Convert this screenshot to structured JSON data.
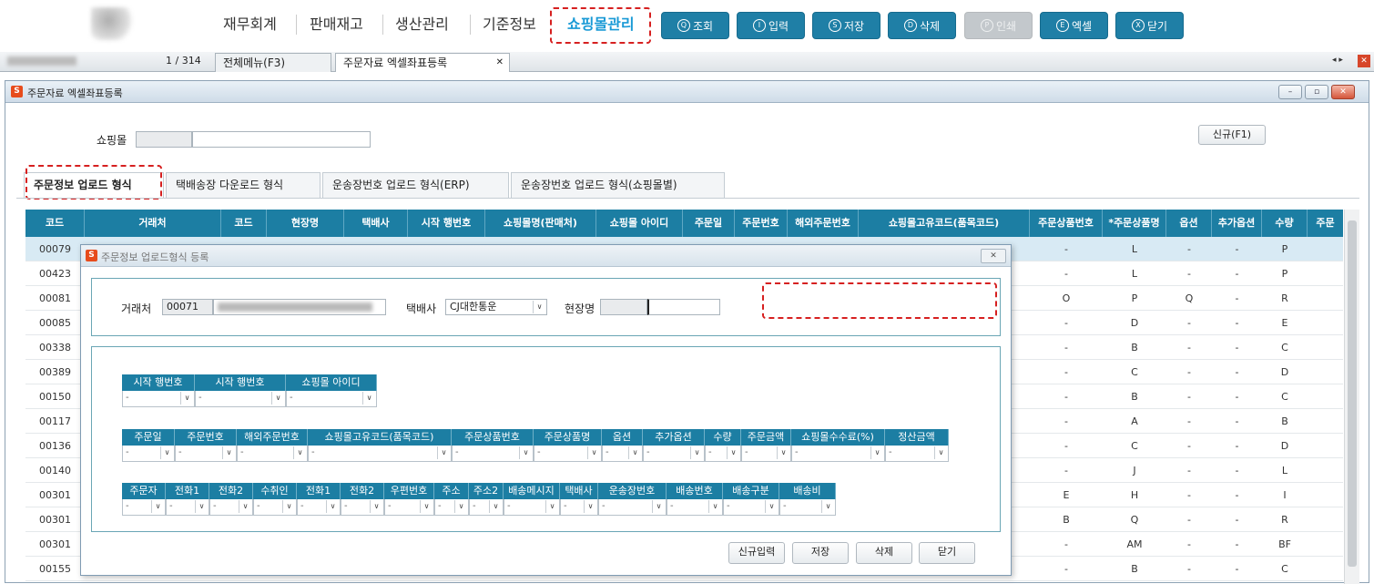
{
  "top_menu": {
    "items": [
      "재무회계",
      "판매재고",
      "생산관리",
      "기준정보",
      "쇼핑몰관리"
    ],
    "active": "쇼핑몰관리"
  },
  "toolbar": {
    "buttons": [
      {
        "key": "Q",
        "label": "조회",
        "enabled": true
      },
      {
        "key": "I",
        "label": "입력",
        "enabled": true
      },
      {
        "key": "S",
        "label": "저장",
        "enabled": true
      },
      {
        "key": "D",
        "label": "삭제",
        "enabled": true
      },
      {
        "key": "P",
        "label": "인쇄",
        "enabled": false
      },
      {
        "key": "E",
        "label": "엑셀",
        "enabled": true
      },
      {
        "key": "X",
        "label": "닫기",
        "enabled": true
      }
    ]
  },
  "program_tabs": {
    "counter": "1 / 314",
    "tabs": [
      {
        "label": "전체메뉴(F3)",
        "active": false
      },
      {
        "label": "주문자료 엑셀좌표등록",
        "active": true,
        "close": "✕"
      }
    ]
  },
  "window": {
    "title": "주문자료 엑셀좌표등록",
    "shop_label": "쇼핑몰",
    "new_button": "신규(F1)",
    "subtabs": [
      "주문정보 업로드 형식",
      "택배송장 다운로드 형식",
      "운송장번호 업로드 형식(ERP)",
      "운송장번호 업로드 형식(쇼핑몰별)"
    ]
  },
  "grid": {
    "columns": [
      "코드",
      "거래처",
      "코드",
      "현장명",
      "택배사",
      "시작 행번호",
      "쇼핑몰명(판매처)",
      "쇼핑몰 아이디",
      "주문일",
      "주문번호",
      "해외주문번호",
      "쇼핑몰고유코드(품목코드)",
      "주문상품번호",
      "*주문상품명",
      "옵션",
      "추가옵션",
      "수량",
      "주문"
    ],
    "rows": [
      {
        "code": "00079",
        "product_no": "-",
        "product_name": "L",
        "option": "-",
        "extra": "-",
        "qty": "P",
        "selected": true
      },
      {
        "code": "00423",
        "product_no": "-",
        "product_name": "L",
        "option": "-",
        "extra": "-",
        "qty": "P"
      },
      {
        "code": "00081",
        "product_no": "O",
        "product_name": "P",
        "option": "Q",
        "extra": "-",
        "qty": "R"
      },
      {
        "code": "00085",
        "product_no": "-",
        "product_name": "D",
        "option": "-",
        "extra": "-",
        "qty": "E"
      },
      {
        "code": "00338",
        "product_no": "-",
        "product_name": "B",
        "option": "-",
        "extra": "-",
        "qty": "C"
      },
      {
        "code": "00389",
        "product_no": "-",
        "product_name": "C",
        "option": "-",
        "extra": "-",
        "qty": "D"
      },
      {
        "code": "00150",
        "product_no": "-",
        "product_name": "B",
        "option": "-",
        "extra": "-",
        "qty": "C"
      },
      {
        "code": "00117",
        "product_no": "-",
        "product_name": "A",
        "option": "-",
        "extra": "-",
        "qty": "B"
      },
      {
        "code": "00136",
        "product_no": "-",
        "product_name": "C",
        "option": "-",
        "extra": "-",
        "qty": "D"
      },
      {
        "code": "00140",
        "product_no": "-",
        "product_name": "J",
        "option": "-",
        "extra": "-",
        "qty": "L"
      },
      {
        "code": "00301",
        "product_no": "E",
        "product_name": "H",
        "option": "-",
        "extra": "-",
        "qty": "I"
      },
      {
        "code": "00301",
        "product_no": "B",
        "product_name": "Q",
        "option": "-",
        "extra": "-",
        "qty": "R"
      },
      {
        "code": "00301",
        "product_no": "-",
        "product_name": "AM",
        "option": "-",
        "extra": "-",
        "qty": "BF"
      },
      {
        "code": "00155",
        "product_no": "-",
        "product_name": "B",
        "option": "-",
        "extra": "-",
        "qty": "C"
      }
    ]
  },
  "dialog": {
    "title": "주문정보 업로드형식 등록",
    "close": "✕",
    "customer_label": "거래처",
    "customer_code": "00071",
    "courier_label": "택배사",
    "courier_value": "CJ대한통운",
    "site_label": "현장명",
    "group1": [
      "시작 행번호",
      "시작 행번호",
      "쇼핑몰 아이디"
    ],
    "group2": [
      "주문일",
      "주문번호",
      "해외주문번호",
      "쇼핑몰고유코드(품목코드)",
      "주문상품번호",
      "주문상품명",
      "옵션",
      "추가옵션",
      "수량",
      "주문금액",
      "쇼핑몰수수료(%)",
      "정산금액"
    ],
    "group3": [
      "주문자",
      "전화1",
      "전화2",
      "수취인",
      "전화1",
      "전화2",
      "우편번호",
      "주소",
      "주소2",
      "배송메시지",
      "택배사",
      "운송장번호",
      "배송번호",
      "배송구분",
      "배송비"
    ],
    "cell_value": "-",
    "dropdown_glyph": "∨",
    "buttons": [
      "신규입력",
      "저장",
      "삭제",
      "닫기"
    ]
  },
  "window_controls": {
    "minimize": "–",
    "restore": "▫",
    "close": "✕"
  },
  "nav_arrows": "◂ ▸",
  "colors": {
    "header": "#1c7ea3",
    "button": "#1f7fa6",
    "accent": "#1a9ad6",
    "highlight": "#d62020"
  }
}
